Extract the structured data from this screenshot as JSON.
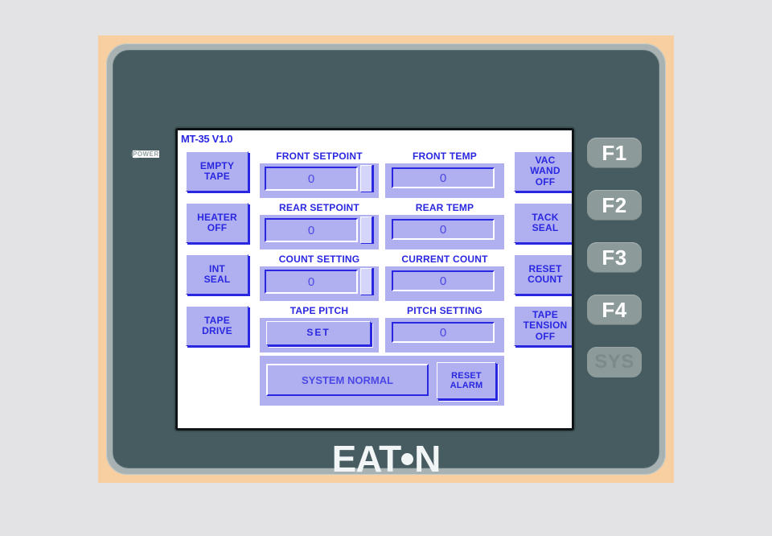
{
  "device": {
    "brand": "EATON",
    "power_label": "POWER",
    "screen_title": "MT-35 V1.0"
  },
  "function_keys": [
    {
      "label": "F1",
      "state": "enabled"
    },
    {
      "label": "F2",
      "state": "enabled"
    },
    {
      "label": "F3",
      "state": "enabled"
    },
    {
      "label": "F4",
      "state": "enabled"
    },
    {
      "label": "SYS",
      "state": "disabled"
    }
  ],
  "left_buttons": [
    {
      "line1": "EMPTY",
      "line2": "TAPE"
    },
    {
      "line1": "HEATER",
      "line2": "OFF"
    },
    {
      "line1": "INT",
      "line2": "SEAL"
    },
    {
      "line1": "TAPE",
      "line2": "DRIVE"
    }
  ],
  "right_buttons": [
    {
      "line1": "VAC",
      "line2": "WAND",
      "line3": "OFF"
    },
    {
      "line1": "TACK",
      "line2": "SEAL",
      "line3": ""
    },
    {
      "line1": "RESET",
      "line2": "COUNT",
      "line3": ""
    },
    {
      "line1": "TAPE",
      "line2": "TENSION",
      "line3": "OFF"
    }
  ],
  "rows": [
    {
      "left_label": "FRONT SETPOINT",
      "left_value": "0",
      "left_editable": true,
      "right_label": "FRONT TEMP",
      "right_value": "0",
      "right_editable": false
    },
    {
      "left_label": "REAR SETPOINT",
      "left_value": "0",
      "left_editable": true,
      "right_label": "REAR TEMP",
      "right_value": "0",
      "right_editable": false
    },
    {
      "left_label": "COUNT SETTING",
      "left_value": "0",
      "left_editable": true,
      "right_label": "CURRENT COUNT",
      "right_value": "0",
      "right_editable": false
    },
    {
      "left_label": "TAPE PITCH",
      "left_value": "SET",
      "left_editable": false,
      "right_label": "PITCH SETTING",
      "right_value": "0",
      "right_editable": false
    }
  ],
  "status": {
    "message": "SYSTEM NORMAL",
    "reset_alarm_line1": "RESET",
    "reset_alarm_line2": "ALARM"
  },
  "colors": {
    "lcd_background": "#ffffff",
    "hmi_blue": "#2a27e0",
    "button_face": "#b0b0f0",
    "bezel_dark": "#475c60",
    "bezel_light": "#a9b2b2",
    "mat_orange": "#f8cfa0",
    "page_background": "#e3e3e5"
  }
}
